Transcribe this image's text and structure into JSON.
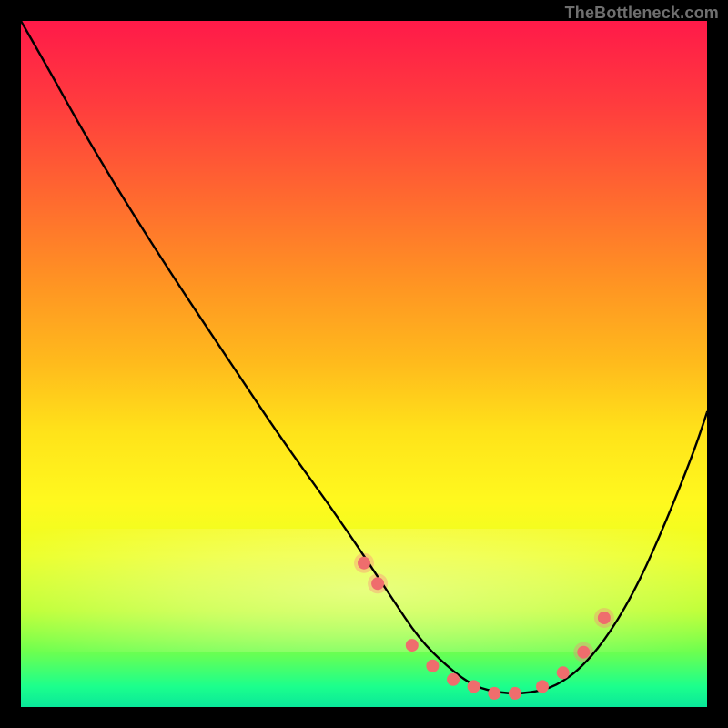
{
  "watermark": "TheBottleneck.com",
  "chart_data": {
    "type": "line",
    "title": "",
    "xlabel": "",
    "ylabel": "",
    "xlim": [
      0,
      100
    ],
    "ylim": [
      0,
      100
    ],
    "grid": false,
    "legend_position": "none",
    "curve": {
      "name": "bottleneck-curve",
      "x": [
        0,
        4,
        9,
        15,
        22,
        30,
        38,
        46,
        54,
        58,
        62,
        66,
        70,
        74,
        78,
        82,
        86,
        90,
        94,
        98,
        100
      ],
      "y": [
        100,
        93,
        84,
        74,
        63,
        51,
        39,
        28,
        16,
        10,
        6,
        3,
        2,
        2,
        3,
        6,
        11,
        18,
        27,
        37,
        43
      ]
    },
    "markers": {
      "name": "highlighted-points",
      "color": "#ef6d6d",
      "x": [
        50,
        52,
        57,
        60,
        63,
        66,
        69,
        72,
        76,
        79,
        82,
        85
      ],
      "y": [
        21,
        18,
        9,
        6,
        4,
        3,
        2,
        2,
        3,
        5,
        8,
        13
      ]
    },
    "halo_markers": {
      "name": "highlighted-points-halo",
      "color": "rgba(255,125,125,0.35)",
      "x": [
        50,
        52,
        82,
        85
      ],
      "y": [
        21,
        18,
        8,
        13
      ]
    },
    "trough_band": {
      "name": "optimal-band",
      "color": "#1cff8c",
      "y_top": 6,
      "y_bottom": 0
    }
  }
}
